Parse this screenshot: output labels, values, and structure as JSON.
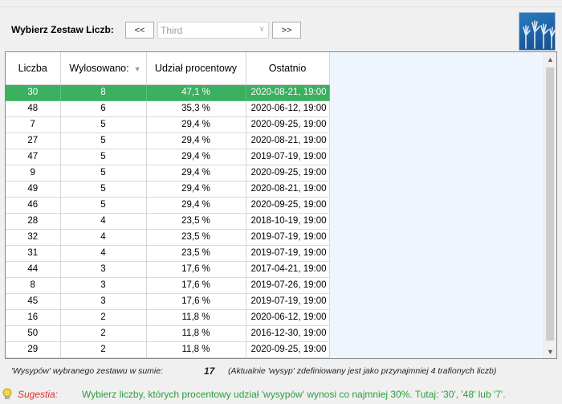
{
  "toolbar": {
    "label": "Wybierz Zestaw Liczb:",
    "prev_label": "<<",
    "next_label": ">>",
    "set_value": "Third"
  },
  "grid": {
    "columns": [
      "Liczba",
      "Wylosowano:",
      "Udział procentowy",
      "Ostatnio"
    ],
    "rows": [
      {
        "n": "30",
        "count": "8",
        "pct": "47,1 %",
        "date": "2020-08-21,  19:00",
        "selected": true
      },
      {
        "n": "48",
        "count": "6",
        "pct": "35,3 %",
        "date": "2020-06-12,  19:00"
      },
      {
        "n": "7",
        "count": "5",
        "pct": "29,4 %",
        "date": "2020-09-25,  19:00"
      },
      {
        "n": "27",
        "count": "5",
        "pct": "29,4 %",
        "date": "2020-08-21,  19:00"
      },
      {
        "n": "47",
        "count": "5",
        "pct": "29,4 %",
        "date": "2019-07-19,  19:00"
      },
      {
        "n": "9",
        "count": "5",
        "pct": "29,4 %",
        "date": "2020-09-25,  19:00"
      },
      {
        "n": "49",
        "count": "5",
        "pct": "29,4 %",
        "date": "2020-08-21,  19:00"
      },
      {
        "n": "46",
        "count": "5",
        "pct": "29,4 %",
        "date": "2020-09-25,  19:00"
      },
      {
        "n": "28",
        "count": "4",
        "pct": "23,5 %",
        "date": "2018-10-19,  19:00"
      },
      {
        "n": "32",
        "count": "4",
        "pct": "23,5 %",
        "date": "2019-07-19,  19:00"
      },
      {
        "n": "31",
        "count": "4",
        "pct": "23,5 %",
        "date": "2019-07-19,  19:00"
      },
      {
        "n": "44",
        "count": "3",
        "pct": "17,6 %",
        "date": "2017-04-21,  19:00"
      },
      {
        "n": "8",
        "count": "3",
        "pct": "17,6 %",
        "date": "2019-07-26,  19:00"
      },
      {
        "n": "45",
        "count": "3",
        "pct": "17,6 %",
        "date": "2019-07-19,  19:00"
      },
      {
        "n": "16",
        "count": "2",
        "pct": "11,8 %",
        "date": "2020-06-12,  19:00"
      },
      {
        "n": "50",
        "count": "2",
        "pct": "11,8 %",
        "date": "2016-12-30,  19:00"
      },
      {
        "n": "29",
        "count": "2",
        "pct": "11,8 %",
        "date": "2020-09-25,  19:00"
      }
    ]
  },
  "summary": {
    "label": "'Wysypów' wybranego zestawu w sumie:",
    "count": "17",
    "note": "(Aktualnie 'wysyp' zdefiniowany jest jako przynajmniej 4 trafionych liczb)"
  },
  "suggestion": {
    "label": "Sugestia:",
    "text": "Wybierz liczby, których procentowy udział 'wysypów' wynosi co najmniej 30%. Tutaj: '30', '48' lub '7'."
  },
  "icons": {
    "logo": "hands-up-logo-icon",
    "bulb": "lightbulb-icon",
    "sort": "sort-desc-icon",
    "dropdown": "chevron-down-icon"
  },
  "colors": {
    "selected_row": "#3ab060",
    "suggestion_label": "#e02b2b",
    "suggestion_text": "#2a9d3b",
    "logo_bg": "#1b5fa2"
  }
}
